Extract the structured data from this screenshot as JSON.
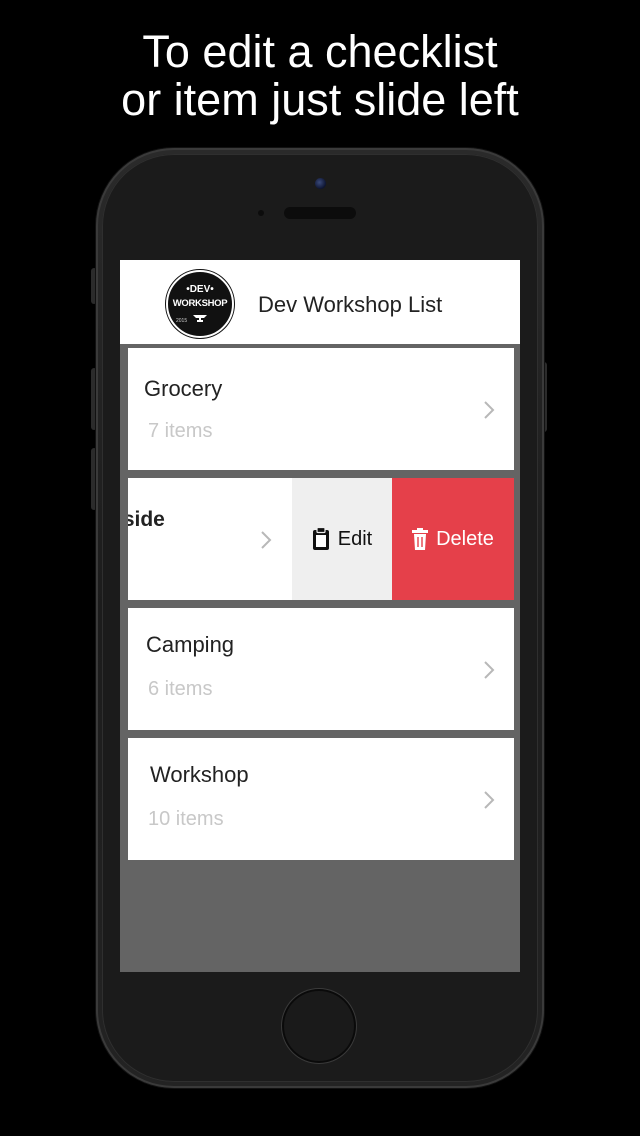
{
  "caption": {
    "line1": "To edit a checklist",
    "line2": "or item just slide left"
  },
  "app": {
    "logo": {
      "top": "•DEV•",
      "main": "WORKSHOP",
      "year": "2015"
    },
    "title": "Dev Workshop List"
  },
  "lists": [
    {
      "name": "Grocery",
      "count": "7 items"
    },
    {
      "name": "nside"
    },
    {
      "name": "Camping",
      "count": "6 items"
    },
    {
      "name": "Workshop",
      "count": "10 items"
    }
  ],
  "swipe_actions": {
    "edit_label": "Edit",
    "delete_label": "Delete"
  },
  "colors": {
    "delete": "#e5404a",
    "edit": "#efefef",
    "list_background": "#646464"
  },
  "icons": [
    "chevron-right-icon",
    "clipboard-icon",
    "trash-icon"
  ]
}
